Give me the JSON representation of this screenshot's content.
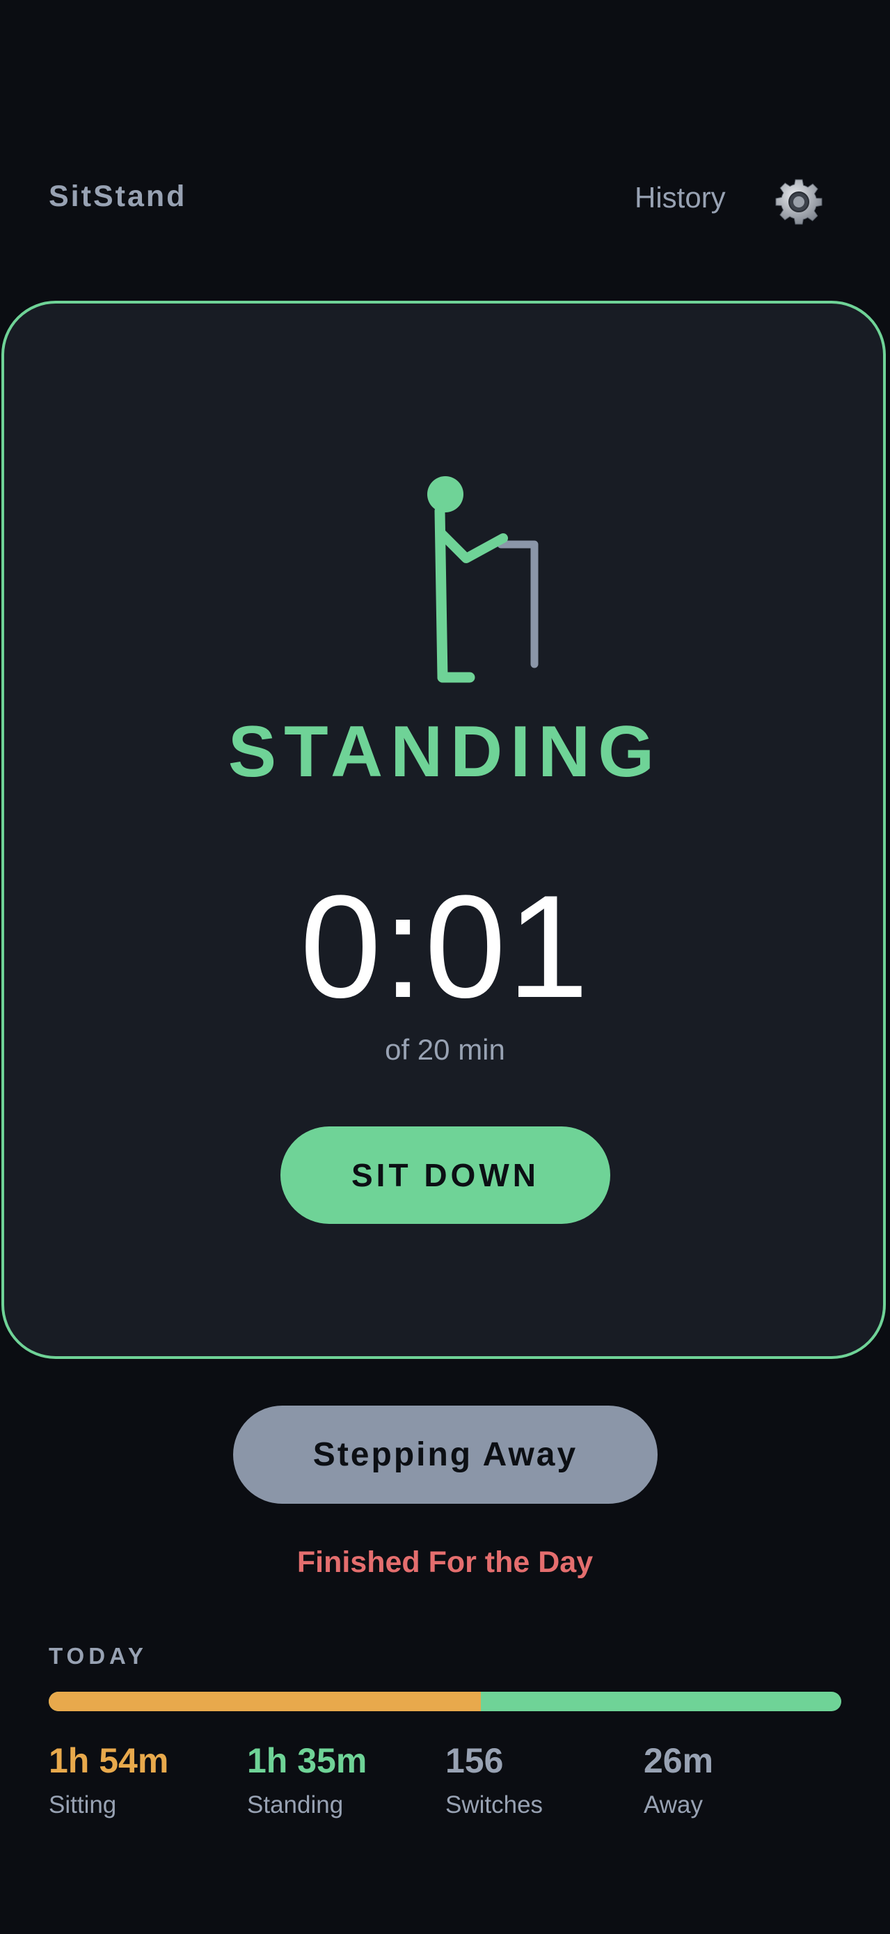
{
  "header": {
    "app_name": "SitStand",
    "history_label": "History",
    "settings_icon": "gear-icon"
  },
  "status": {
    "state": "STANDING",
    "timer": "0:01",
    "goal": "of 20 min",
    "toggle_label": "SIT DOWN",
    "figure_icon": "standing-person-icon"
  },
  "actions": {
    "away_label": "Stepping Away",
    "finish_label": "Finished For the Day"
  },
  "today": {
    "label": "TODAY",
    "sitting_fraction": 0.545,
    "stats": [
      {
        "value": "1h 54m",
        "label": "Sitting"
      },
      {
        "value": "1h 35m",
        "label": "Standing"
      },
      {
        "value": "156",
        "label": "Switches"
      },
      {
        "value": "26m",
        "label": "Away"
      }
    ]
  },
  "colors": {
    "accent": "#6fd397",
    "sitting": "#e8a94c",
    "danger": "#e46e6e",
    "muted": "#98a2b3",
    "card": "#181c24",
    "background": "#0b0d12"
  }
}
